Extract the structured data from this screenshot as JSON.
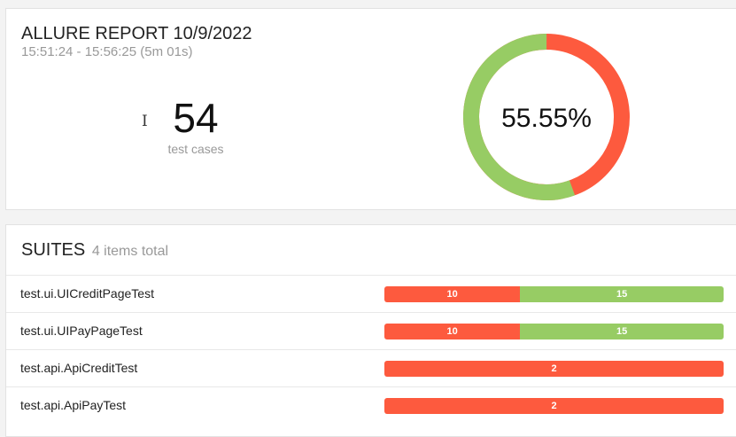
{
  "summary": {
    "title": "ALLURE REPORT 10/9/2022",
    "time_range": "15:51:24 - 15:56:25 (5m 01s)",
    "test_count": "54",
    "test_count_label": "test cases",
    "success_rate": "55.55%",
    "donut": {
      "passed_fraction": 0.5555,
      "colors": {
        "passed": "#97cc64",
        "failed": "#fd5a3e"
      }
    }
  },
  "suites": {
    "title": "SUITES",
    "subtitle": "4 items total",
    "items": [
      {
        "name": "test.ui.UICreditPageTest",
        "failed": 10,
        "passed": 15
      },
      {
        "name": "test.ui.UIPayPageTest",
        "failed": 10,
        "passed": 15
      },
      {
        "name": "test.api.ApiCreditTest",
        "failed": 2,
        "passed": 0
      },
      {
        "name": "test.api.ApiPayTest",
        "failed": 2,
        "passed": 0
      }
    ]
  },
  "colors": {
    "failed": "#fd5a3e",
    "passed": "#97cc64"
  }
}
